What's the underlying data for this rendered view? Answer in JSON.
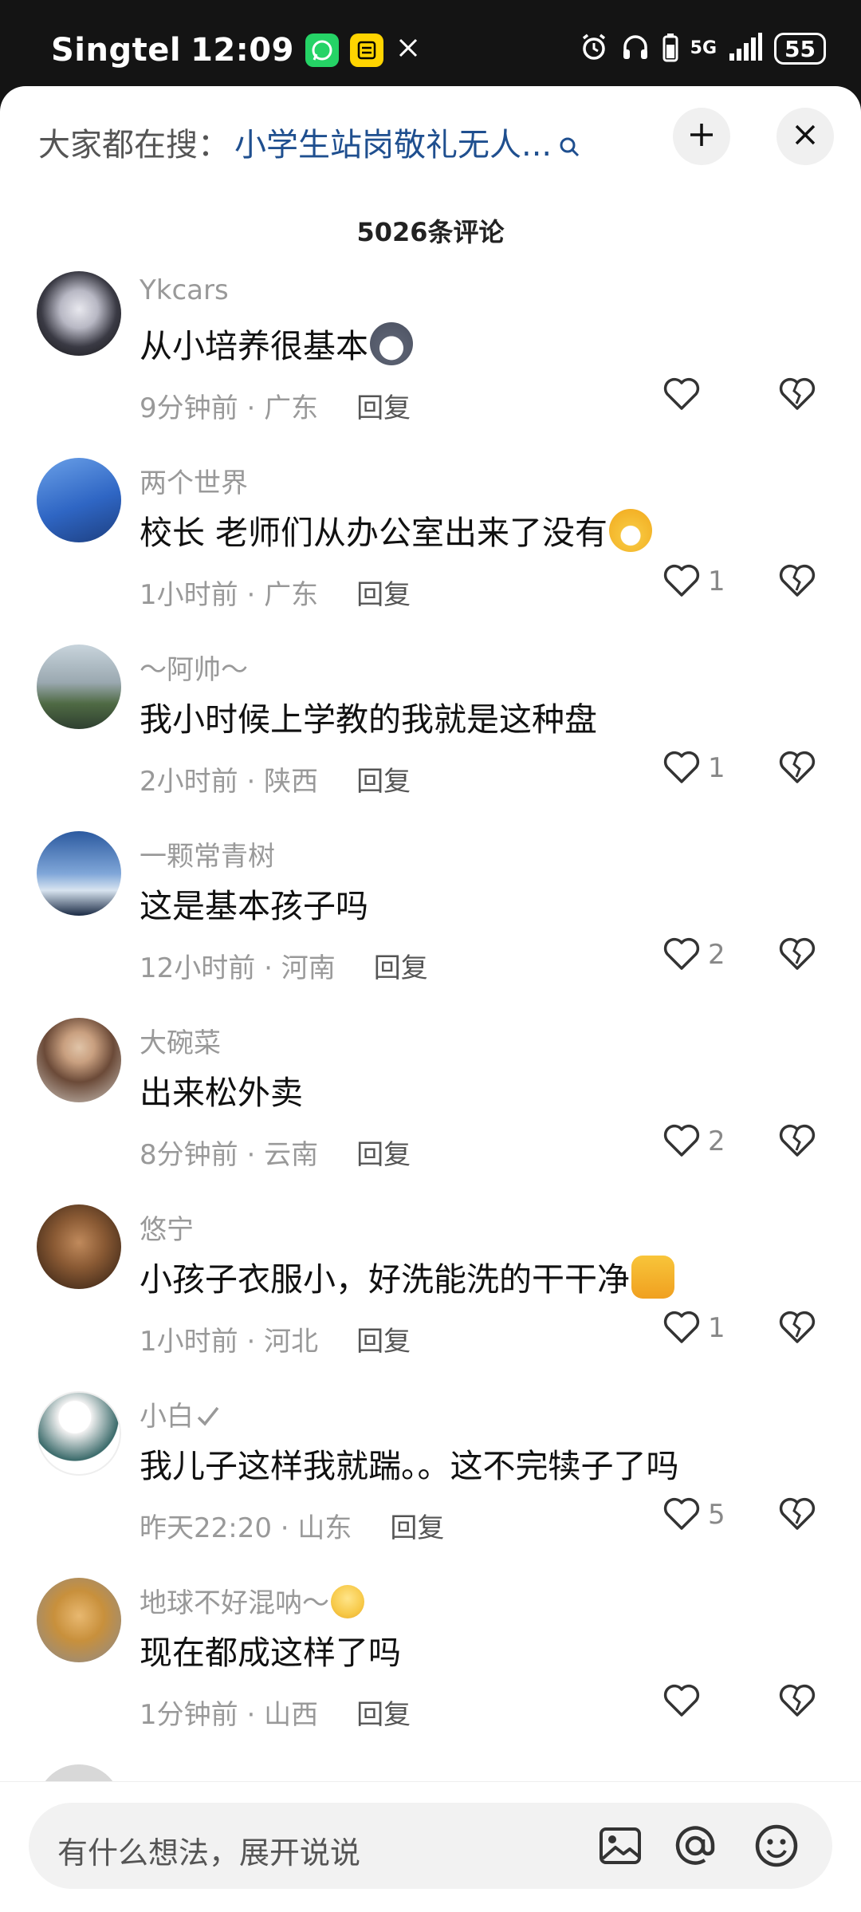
{
  "status_bar": {
    "carrier": "Singtel",
    "time": "12:09",
    "network": "5G",
    "battery": "55"
  },
  "search_bar": {
    "label": "大家都在搜：",
    "query": "小学生站岗敬礼无人..."
  },
  "comment_count": "5026条评论",
  "comments": [
    {
      "name": "Ykcars",
      "text": "从小培养很基本",
      "time": "9分钟前",
      "location": "广东",
      "reply": "回复",
      "likes": ""
    },
    {
      "name": "两个世界",
      "text": "校长 老师们从办公室出来了没有",
      "time": "1小时前",
      "location": "广东",
      "reply": "回复",
      "likes": "1"
    },
    {
      "name": "～阿帅～",
      "text": "我小时候上学教的我就是这种盘",
      "time": "2小时前",
      "location": "陕西",
      "reply": "回复",
      "likes": "1"
    },
    {
      "name": "一颗常青树",
      "text": "这是基本孩子吗",
      "time": "12小时前",
      "location": "河南",
      "reply": "回复",
      "likes": "2"
    },
    {
      "name": "大碗菜",
      "text": "出来松外卖",
      "time": "8分钟前",
      "location": "云南",
      "reply": "回复",
      "likes": "2"
    },
    {
      "name": "悠宁",
      "text": "小孩子衣服小，好洗能洗的干干净",
      "time": "1小时前",
      "location": "河北",
      "reply": "回复",
      "likes": "1"
    },
    {
      "name": "小白",
      "text": "我儿子这样我就踹。。这不完犊子了吗",
      "time": "昨天22:20",
      "location": "山东",
      "reply": "回复",
      "likes": "5"
    },
    {
      "name": "地球不好混呐～",
      "text": "现在都成这样了吗",
      "time": "1分钟前",
      "location": "山西",
      "reply": "回复",
      "likes": ""
    }
  ],
  "input": {
    "placeholder": "有什么想法，展开说说"
  }
}
